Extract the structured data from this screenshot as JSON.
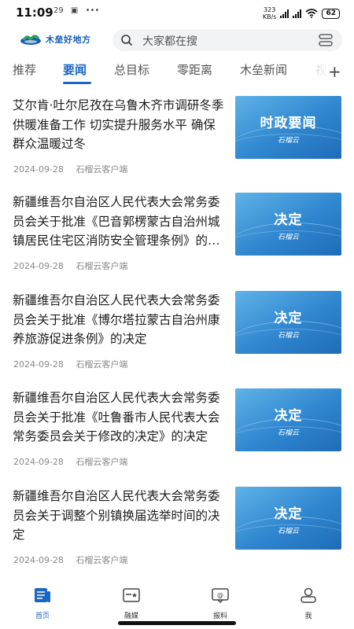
{
  "status_bar": {
    "time": "11:09",
    "notif_icons": [
      "29",
      "▣",
      "•••"
    ],
    "net_speed_value": "323",
    "net_speed_unit": "KB/s",
    "battery": "62"
  },
  "header": {
    "logo_text": "木垒好地方",
    "search_placeholder": "大家都在搜"
  },
  "tabs": [
    {
      "label": "推荐"
    },
    {
      "label": "要闻"
    },
    {
      "label": "总目标"
    },
    {
      "label": "零距离"
    },
    {
      "label": "木垒新闻"
    },
    {
      "label": "视"
    }
  ],
  "articles": [
    {
      "title": "艾尔肯·吐尔尼孜在乌鲁木齐市调研冬季供暖准备工作 切实提升服务水平 确保群众温暖过冬",
      "date": "2024-09-28",
      "source": "石榴云客户端",
      "thumb_text": "时政要闻",
      "thumb_sub": "石榴云"
    },
    {
      "title": "新疆维吾尔自治区人民代表大会常务委员会关于批准《巴音郭楞蒙古自治州城镇居民住宅区消防安全管理条例》的决定",
      "date": "2024-09-28",
      "source": "石榴云客户端",
      "thumb_text": "决定",
      "thumb_sub": "石榴云"
    },
    {
      "title": "新疆维吾尔自治区人民代表大会常务委员会关于批准《博尔塔拉蒙古自治州康养旅游促进条例》的决定",
      "date": "2024-09-28",
      "source": "石榴云客户端",
      "thumb_text": "决定",
      "thumb_sub": "石榴云"
    },
    {
      "title": "新疆维吾尔自治区人民代表大会常务委员会关于批准《吐鲁番市人民代表大会常务委员会关于修改的决定》的决定",
      "date": "2024-09-28",
      "source": "石榴云客户端",
      "thumb_text": "决定",
      "thumb_sub": "石榴云"
    },
    {
      "title": "新疆维吾尔自治区人民代表大会常务委员会关于调整个别镇换届选举时间的决定",
      "date": "2024-09-28",
      "source": "石榴云客户端",
      "thumb_text": "决定",
      "thumb_sub": "石榴云"
    }
  ],
  "bottom_nav": [
    {
      "label": "首页",
      "icon": "home-icon",
      "active": true
    },
    {
      "label": "融媒",
      "icon": "media-icon",
      "active": false
    },
    {
      "label": "报料",
      "icon": "report-icon",
      "active": false
    },
    {
      "label": "我",
      "icon": "profile-icon",
      "active": false
    }
  ],
  "colors": {
    "accent": "#1a66c4",
    "thumb_blue": "#2f86cf"
  }
}
